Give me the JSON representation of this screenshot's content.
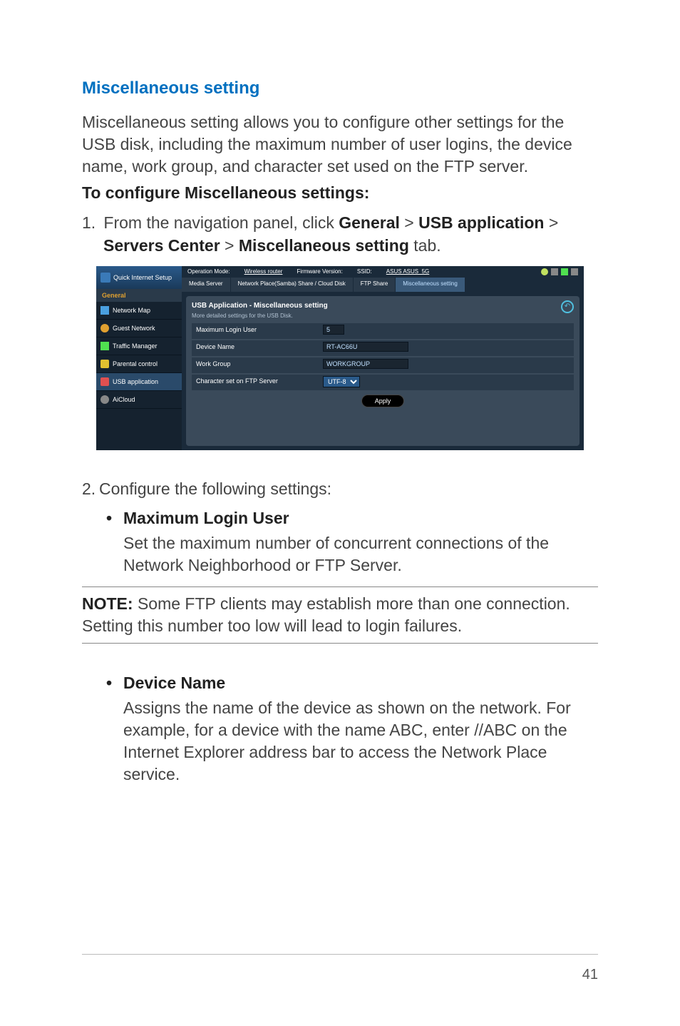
{
  "heading": "Miscellaneous setting",
  "intro": "Miscellaneous setting allows you to configure other settings for the USB disk, including the maximum number of user logins, the device name, work group, and character set used on the FTP server.",
  "subheading": "To configure Miscellaneous settings:",
  "step1": {
    "num": "1.",
    "pre": "From the navigation panel, click ",
    "b1": "General",
    "gt1": " > ",
    "b2": "USB application",
    "gt2": " > ",
    "b3": "Servers Center",
    "gt3": " > ",
    "b4": "Miscellaneous setting",
    "post": " tab."
  },
  "router": {
    "qis": "Quick Internet Setup",
    "general": "General",
    "nav": {
      "map": "Network Map",
      "guest": "Guest Network",
      "traffic": "Traffic Manager",
      "parental": "Parental control",
      "usb": "USB application",
      "cloud": "AiCloud"
    },
    "top": {
      "opmode_l": "Operation Mode:",
      "opmode_v": "Wireless router",
      "fw": "Firmware Version:",
      "ssid_l": "SSID:",
      "ssid_v": "ASUS  ASUS_5G"
    },
    "tabs": {
      "media": "Media Server",
      "np": "Network Place(Samba) Share / Cloud Disk",
      "ftp": "FTP Share",
      "misc": "Miscellaneous setting"
    },
    "panel": {
      "title": "USB Application - Miscellaneous setting",
      "sub": "More detailed settings for the USB Disk.",
      "rows": {
        "maxlogin_l": "Maximum Login User",
        "maxlogin_v": "5",
        "device_l": "Device Name",
        "device_v": "RT-AC66U",
        "work_l": "Work Group",
        "work_v": "WORKGROUP",
        "charset_l": "Character set on FTP Server",
        "charset_v": "UTF-8"
      },
      "apply": "Apply",
      "help": "↶"
    }
  },
  "step2": {
    "num": "2.",
    "text": "Configure the following settings:"
  },
  "bullets": {
    "maxlogin": {
      "label": "Maximum Login User",
      "body": "Set the maximum number of concurrent connections of the Network Neighborhood or FTP Server."
    },
    "device": {
      "label": "Device Name",
      "body": "Assigns the name of the device as shown on the network. For example, for a device with the name ABC, enter //ABC on the Internet Explorer address bar to access the Network Place service."
    }
  },
  "note": {
    "label": "NOTE:",
    "text": " Some FTP clients may establish more than one connection. Setting this number too low will lead to login failures."
  },
  "pagenum": "41"
}
